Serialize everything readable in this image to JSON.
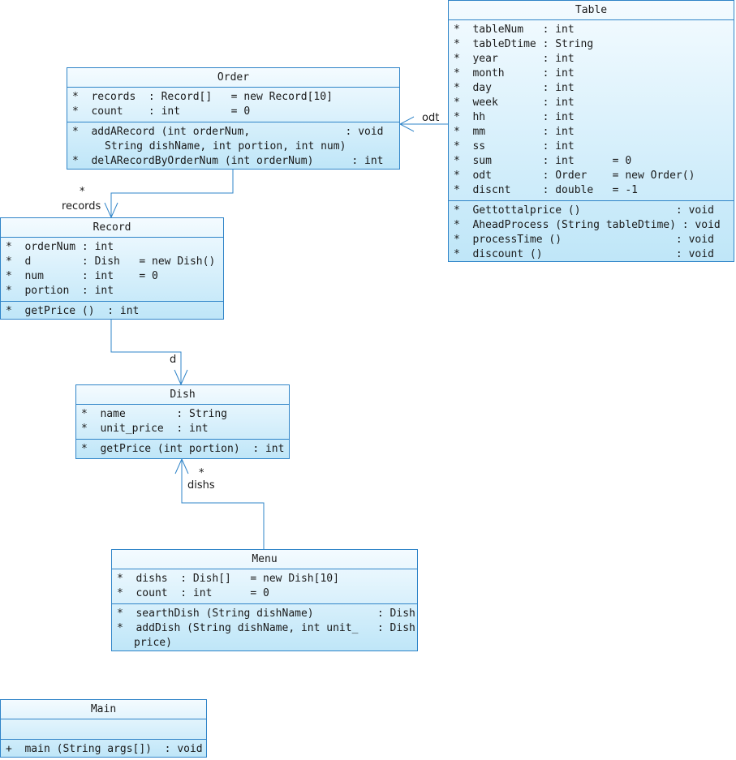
{
  "classes": {
    "table": {
      "name": "Table",
      "attributes": [
        "*  tableNum   : int",
        "*  tableDtime : String",
        "*  year       : int",
        "*  month      : int",
        "*  day        : int",
        "*  week       : int",
        "*  hh         : int",
        "*  mm         : int",
        "*  ss         : int",
        "*  sum        : int      = 0",
        "*  odt        : Order    = new Order()",
        "*  discnt     : double   = -1"
      ],
      "operations": [
        "*  Gettottalprice ()               : void",
        "*  AheadProcess (String tableDtime) : void",
        "*  processTime ()                  : void",
        "*  discount ()                     : void"
      ]
    },
    "order": {
      "name": "Order",
      "attributes": [
        "*  records  : Record[]   = new Record[10]",
        "*  count    : int        = 0"
      ],
      "operations": [
        "*  addARecord (int orderNum,               : void",
        "String dishName, int portion, int num)",
        "*  delARecordByOrderNum (int orderNum)      : int"
      ]
    },
    "record": {
      "name": "Record",
      "attributes": [
        "*  orderNum : int",
        "*  d        : Dish   = new Dish()",
        "*  num      : int    = 0",
        "*  portion  : int"
      ],
      "operations": [
        "*  getPrice ()  : int"
      ]
    },
    "dish": {
      "name": "Dish",
      "attributes": [
        "*  name        : String",
        "*  unit_price  : int"
      ],
      "operations": [
        "*  getPrice (int portion)  : int"
      ]
    },
    "menu": {
      "name": "Menu",
      "attributes": [
        "*  dishs  : Dish[]   = new Dish[10]",
        "*  count  : int      = 0"
      ],
      "operations": [
        "*  searthDish (String dishName)          : Dish",
        "*  addDish (String dishName, int unit_   : Dish",
        "price)"
      ]
    },
    "main": {
      "name": "Main",
      "attributes": [],
      "operations": [
        "+  main (String args[])  : void"
      ]
    }
  },
  "associations": {
    "table_order": {
      "role": "odt"
    },
    "order_record": {
      "multiplicity": "*",
      "role": "records"
    },
    "record_dish": {
      "role": "d"
    },
    "menu_dish": {
      "multiplicity": "*",
      "role": "dishs"
    }
  },
  "colors": {
    "border": "#2f84c8",
    "fill_top": "#f4fbff",
    "fill_bottom": "#bfe6f8",
    "line": "#2f84c8"
  }
}
